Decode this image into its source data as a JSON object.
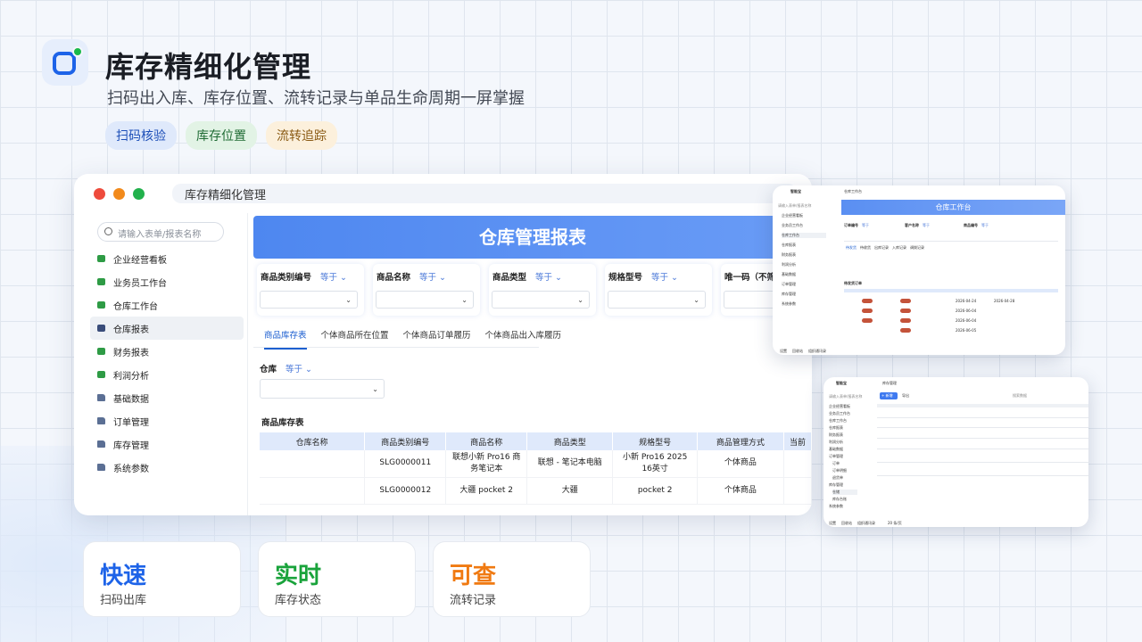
{
  "header": {
    "title": "库存精细化管理",
    "subtitle": "扫码出入库、库存位置、流转记录与单品生命周期一屏掌握",
    "tags": [
      "扫码核验",
      "库存位置",
      "流转追踪"
    ]
  },
  "main_window": {
    "address": "库存精细化管理",
    "search_placeholder": "请输入表单/报表名称",
    "menu": [
      "企业经营看板",
      "业务员工作台",
      "仓库工作台",
      "仓库报表",
      "财务报表",
      "利润分析",
      "基础数据",
      "订单管理",
      "库存管理",
      "系统参数"
    ],
    "active_menu": "仓库报表",
    "banner": "仓库管理报表",
    "filters": [
      {
        "label": "商品类别编号",
        "op": "等于"
      },
      {
        "label": "商品名称",
        "op": "等于"
      },
      {
        "label": "商品类型",
        "op": "等于"
      },
      {
        "label": "规格型号",
        "op": "等于"
      },
      {
        "label": "唯一码（不筛...",
        "op": ""
      }
    ],
    "tabs": [
      "商品库存表",
      "个体商品所在位置",
      "个体商品订单履历",
      "个体商品出入库履历"
    ],
    "warehouse_label": "仓库",
    "warehouse_op": "等于",
    "table_title": "商品库存表",
    "table_headers": [
      "仓库名称",
      "商品类别编号",
      "商品名称",
      "商品类型",
      "规格型号",
      "商品管理方式",
      "当前"
    ],
    "table_rows": [
      [
        "",
        "SLG0000011",
        "联想小新 Pro16 商务笔记本",
        "联想 - 笔记本电脑",
        "小新 Pro16 2025 16英寸",
        "个体商品",
        ""
      ],
      [
        "",
        "SLG0000012",
        "大疆 pocket 2",
        "大疆",
        "pocket 2",
        "个体商品",
        ""
      ]
    ]
  },
  "mini1": {
    "app": "智能宝",
    "breadcrumb": "仓库工作台",
    "banner": "仓库工作台",
    "search_placeholder": "请输入表单/报表名称",
    "menu": [
      "企业经营看板",
      "业务员工作台",
      "仓库工作台",
      "仓库报表",
      "财务报表",
      "利润分析",
      "基础数据",
      "订单管理",
      "库存管理",
      "系统参数"
    ],
    "filters": [
      "订单编号",
      "客户名称",
      "商品编号"
    ],
    "op": "等于",
    "tabs": [
      "待发货",
      "待收货",
      "出库记录",
      "入库记录",
      "调拨记录"
    ],
    "section": "待发货订单",
    "dates": [
      "2026-04-24",
      "2026-04-28",
      "2026-06-04",
      "2026-06-05"
    ],
    "footer": [
      "设置",
      "回收站",
      "组织通讯录"
    ]
  },
  "mini2": {
    "app": "智能宝",
    "breadcrumb": "库存管理",
    "search_placeholder": "请输入表单/报表名称",
    "toolbar_add": "+ 新增",
    "toolbar_export": "导出",
    "search_data": "搜索数据",
    "menu": [
      "企业经营看板",
      "业务员工作台",
      "仓库工作台",
      "仓库报表",
      "财务报表",
      "利润分析",
      "基础数据",
      "订单管理",
      "订单",
      "订单明细",
      "退货单",
      "库存管理",
      "仓储",
      "库存台账",
      "系统参数"
    ],
    "footer": [
      "设置",
      "回收站",
      "组织通讯录"
    ],
    "pager": "20 条/页"
  },
  "stats": [
    {
      "big": "快速",
      "small": "扫码出库",
      "color": "#1d63e8"
    },
    {
      "big": "实时",
      "small": "库存状态",
      "color": "#19a33b"
    },
    {
      "big": "可查",
      "small": "流转记录",
      "color": "#f07a12"
    }
  ]
}
